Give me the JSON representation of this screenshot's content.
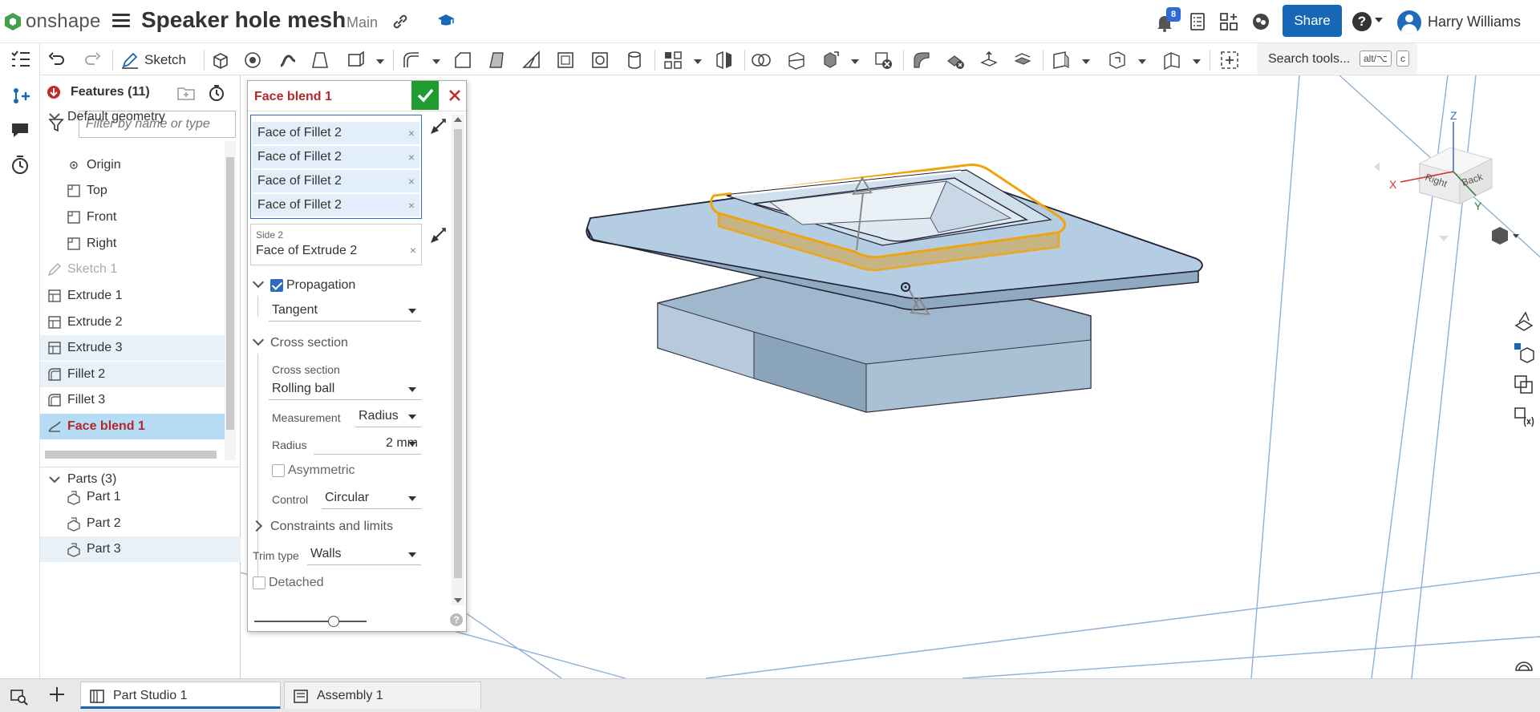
{
  "app": {
    "logo_text": "onshape",
    "document_title": "Speaker hole mesh",
    "branch": "Main"
  },
  "header": {
    "notifications_count": "8",
    "share_label": "Share",
    "help_label": "?",
    "user_name": "Harry Williams"
  },
  "toolbar": {
    "sketch_label": "Sketch",
    "search_label": "Search tools...",
    "search_shortcut_1": "alt/⌥",
    "search_shortcut_2": "c"
  },
  "features": {
    "title": "Features (11)",
    "filter_placeholder": "Filter by name or type",
    "items": [
      {
        "label": "Default geometry",
        "state": "normal"
      },
      {
        "label": "Origin",
        "state": "normal"
      },
      {
        "label": "Top",
        "state": "normal"
      },
      {
        "label": "Front",
        "state": "normal"
      },
      {
        "label": "Right",
        "state": "normal"
      },
      {
        "label": "Sketch 1",
        "state": "dim"
      },
      {
        "label": "Extrude 1",
        "state": "normal"
      },
      {
        "label": "Extrude 2",
        "state": "normal"
      },
      {
        "label": "Extrude 3",
        "state": "selected"
      },
      {
        "label": "Fillet 2",
        "state": "selected"
      },
      {
        "label": "Fillet 3",
        "state": "normal"
      },
      {
        "label": "Face blend 1",
        "state": "active"
      }
    ],
    "parts_title": "Parts (3)",
    "parts": [
      {
        "label": "Part 1"
      },
      {
        "label": "Part 2"
      },
      {
        "label": "Part 3"
      }
    ]
  },
  "dialog": {
    "title": "Face blend 1",
    "side1_selections": [
      "Face of Fillet 2",
      "Face of Fillet 2",
      "Face of Fillet 2",
      "Face of Fillet 2"
    ],
    "side2_label": "Side 2",
    "side2_value": "Face of Extrude 2",
    "remove_symbol": "×",
    "propagation_label": "Propagation",
    "propagation_checked": true,
    "propagation_value": "Tangent",
    "cross_section_group": "Cross section",
    "cross_section_label": "Cross section",
    "cross_section_value": "Rolling ball",
    "measurement_label": "Measurement",
    "measurement_value": "Radius",
    "radius_label": "Radius",
    "radius_value": "2 mm",
    "asymmetric_label": "Asymmetric",
    "control_label": "Control",
    "control_value": "Circular",
    "constraints_label": "Constraints and limits",
    "trim_type_label": "Trim type",
    "trim_type_value": "Walls",
    "detached_label": "Detached",
    "help_symbol": "?"
  },
  "viewcube": {
    "top_label": "Z",
    "x_label": "X",
    "y_label": "Y",
    "right_face": "Right",
    "back_face": "Back"
  },
  "tabs": [
    {
      "label": "Part Studio 1",
      "active": true
    },
    {
      "label": "Assembly 1",
      "active": false
    }
  ],
  "colors": {
    "accent": "#1767b7",
    "ok_green": "#1f9b2f",
    "active_red": "#b3282d",
    "part_blue": "#a9c6de",
    "highlight": "#f0a30a"
  },
  "icons": {
    "menu": "menu-icon",
    "link": "link-icon",
    "learning": "learning-center-icon",
    "notifications": "bell-icon",
    "tasks": "tasks-icon",
    "apps": "app-store-icon",
    "collaboration": "collaboration-icon"
  }
}
